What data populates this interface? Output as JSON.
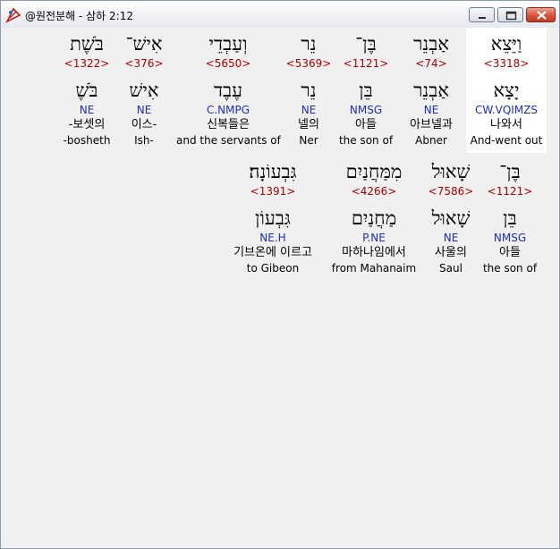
{
  "window": {
    "title": "@원전분해 - 삼하 2:12"
  },
  "row1": [
    {
      "heb": "וַיֵּצֵא",
      "strong": "<3318>",
      "lemma": "יָצָא",
      "morph": "CW.VQIMZS",
      "kor": "나와서",
      "eng": "And-went out"
    },
    {
      "heb": "אַבְנֵר",
      "strong": "<74>",
      "lemma": "אַבְנֵר",
      "morph": "NE",
      "kor": "아브넬과",
      "eng": "Abner"
    },
    {
      "heb": "בֶּן־",
      "strong": "<1121>",
      "lemma": "בֵּן",
      "morph": "NMSG",
      "kor": "아들",
      "eng": "the son of"
    },
    {
      "heb": "נֵר",
      "strong": "<5369>",
      "lemma": "נֵר",
      "morph": "NE",
      "kor": "넬의",
      "eng": "Ner"
    },
    {
      "heb": "וְעַבְדֵי",
      "strong": "<5650>",
      "lemma": "עֶבֶד",
      "morph": "C.NMPG",
      "kor": "신복들은",
      "eng": "and the servants of"
    },
    {
      "heb": "אִישׁ־",
      "strong": "<376>",
      "lemma": "אִישׁ",
      "morph": "NE",
      "kor": "이스-",
      "eng": "Ish-"
    },
    {
      "heb": "בֹּשֶׁת",
      "strong": "<1322>",
      "lemma": "בֹּשֶׁ",
      "morph": "NE",
      "kor": "-보셋의",
      "eng": "-bosheth"
    }
  ],
  "row2": [
    {
      "heb": "בֶּן־",
      "strong": "<1121>",
      "lemma": "בֵּן",
      "morph": "NMSG",
      "kor": "아들",
      "eng": "the son of"
    },
    {
      "heb": "שָׁאוּל",
      "strong": "<7586>",
      "lemma": "שָׁאוּל",
      "morph": "NE",
      "kor": "사울의",
      "eng": "Saul"
    },
    {
      "heb": "מִמַּחֲנַיִם",
      "strong": "<4266>",
      "lemma": "מַחֲנַיִם",
      "morph": "P.NE",
      "kor": "마하나임에서",
      "eng": "from Mahanaim"
    },
    {
      "heb": "גִּבְעוֹנָה׃",
      "strong": "<1391>",
      "lemma": "גִּבְעוֹן",
      "morph": "NE.H",
      "kor": "기브온에 이르고",
      "eng": "to Gibeon"
    }
  ]
}
